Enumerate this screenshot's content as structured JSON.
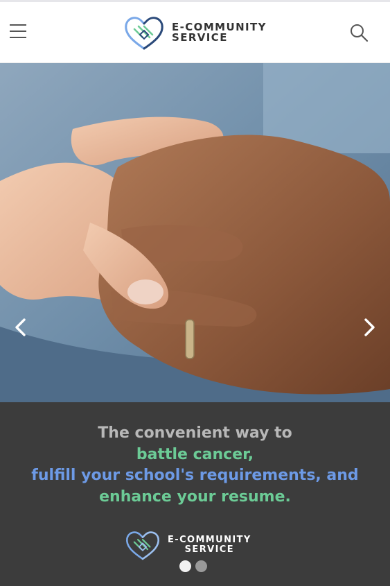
{
  "header": {
    "brand_line1": "E-COMMUNITY",
    "brand_line2": "SERVICE",
    "menu_icon": "hamburger-menu-icon",
    "search_icon": "search-icon"
  },
  "hero": {
    "image": "clasped-hands-photo",
    "prev_icon": "chevron-left-icon",
    "next_icon": "chevron-right-icon"
  },
  "caption": {
    "line1": "The convenient way to",
    "line2": "battle cancer,",
    "line3": "fulfill your school's requirements, and",
    "line4": "enhance your resume.",
    "brand_line1": "E-COMMUNITY",
    "brand_line2": "SERVICE",
    "slides": [
      {
        "active": true
      },
      {
        "active": false
      }
    ]
  },
  "colors": {
    "caption_bg": "#3c3c3c",
    "gray_text": "#b8b8b8",
    "green_text": "#6ccb96",
    "blue_text": "#6d9ae6"
  }
}
